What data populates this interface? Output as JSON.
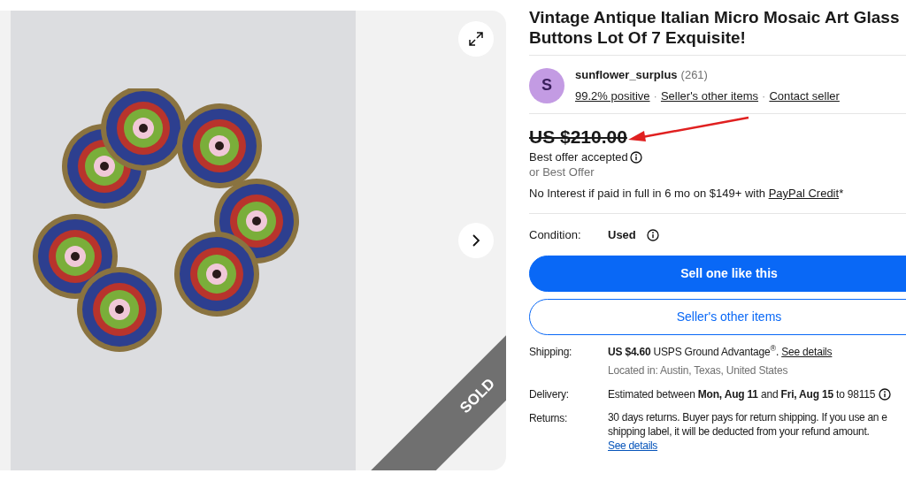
{
  "gallery": {
    "badge": "SOLD"
  },
  "title": "Vintage Antique Italian Micro Mosaic Art Glass Buttons Lot Of 7 Exquisite!",
  "seller": {
    "initial": "S",
    "name": "sunflower_surplus",
    "count": "(261)",
    "separator": "·",
    "links": [
      "99.2% positive",
      "Seller's other items",
      "Contact seller"
    ]
  },
  "price": {
    "amount": "US $210.00",
    "struck": true,
    "note": "Best offer accepted",
    "offer": "or Best Offer"
  },
  "financing": {
    "text": "No Interest if paid in full in 6 mo on $149+ with ",
    "link": "PayPal Credit",
    "suffix": "*"
  },
  "condition": {
    "label": "Condition:",
    "value": "Used"
  },
  "buttons": [
    {
      "label": "Sell one like this",
      "kind": "primary"
    },
    {
      "label": "Seller's other items",
      "kind": "secondary"
    }
  ],
  "shipping": {
    "label": "Shipping:",
    "text": "**US $4.60** USPS Ground Advantage$^{®}$. ",
    "link": "See details",
    "location": "Located in: Austin, Texas, United States"
  },
  "delivery": {
    "label": "Delivery:",
    "text": "Estimated between **Mon, Aug 11** and **Fri, Aug 15** to 98115"
  },
  "returns": {
    "label": "Returns:",
    "lines": [
      "30 days returns. Buyer pays for return shipping. If you use an e",
      "shipping label, it will be deducted from your refund amount."
    ],
    "link": "See details"
  }
}
